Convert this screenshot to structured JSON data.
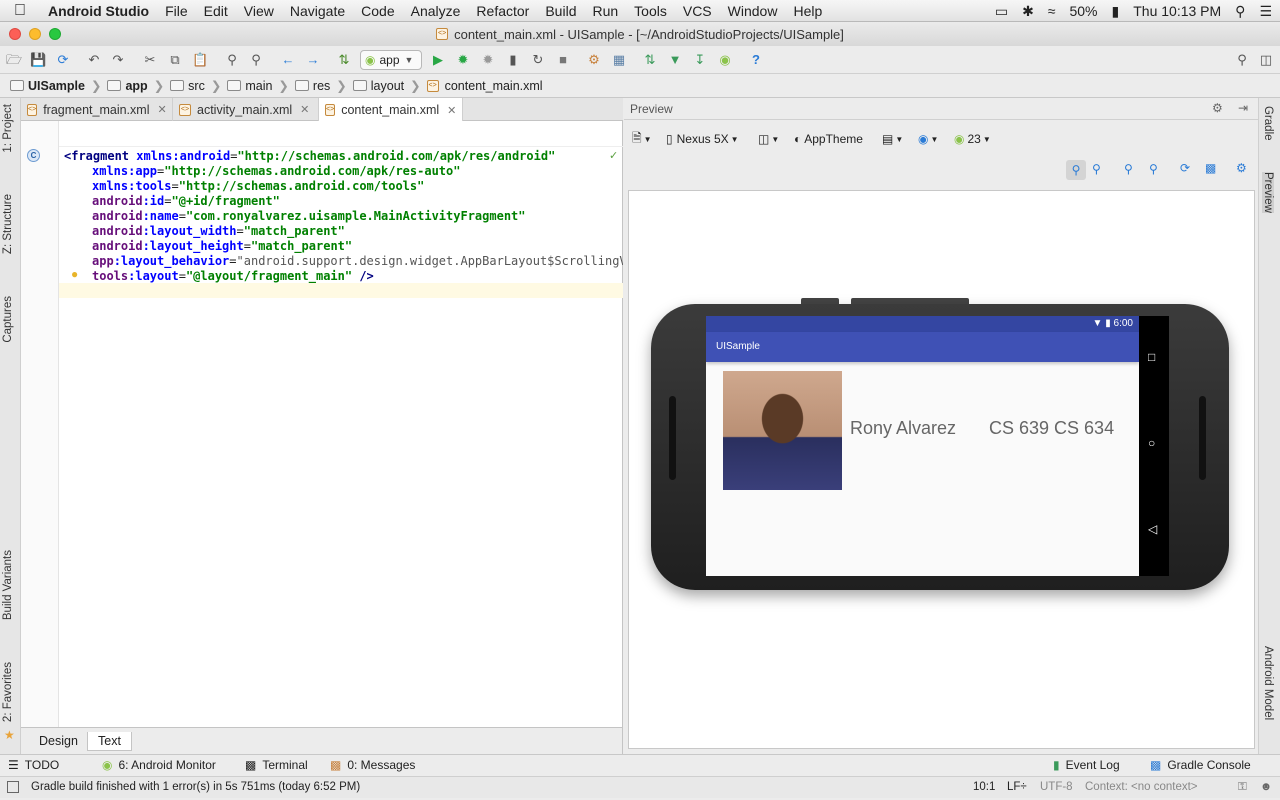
{
  "menubar": {
    "app_name": "Android Studio",
    "items": [
      "File",
      "Edit",
      "View",
      "Navigate",
      "Code",
      "Analyze",
      "Refactor",
      "Build",
      "Run",
      "Tools",
      "VCS",
      "Window",
      "Help"
    ],
    "battery": "50%",
    "clock": "Thu 10:13 PM"
  },
  "window": {
    "title": "content_main.xml - UISample - [~/AndroidStudioProjects/UISample]"
  },
  "toolbar": {
    "run_config": "app",
    "help_glyph": "?"
  },
  "breadcrumb": [
    "UISample",
    "app",
    "src",
    "main",
    "res",
    "layout",
    "content_main.xml"
  ],
  "editor_tabs": [
    {
      "label": "fragment_main.xml"
    },
    {
      "label": "activity_main.xml"
    },
    {
      "label": "content_main.xml"
    }
  ],
  "code": {
    "gutter_badge": "C",
    "line1_tag": "<fragment",
    "line1_attr": "xmlns:android",
    "line1_val": "\"http://schemas.android.com/apk/res/android\"",
    "line2_attr": "xmlns:app",
    "line2_val": "\"http://schemas.android.com/apk/res-auto\"",
    "line3_attr": "xmlns:tools",
    "line3_val": "\"http://schemas.android.com/tools\"",
    "line4_ns": "android",
    "line4_attr": ":id",
    "line4_val": "\"@+id/fragment\"",
    "line5_ns": "android",
    "line5_attr": ":name",
    "line5_val": "\"com.ronyalvarez.uisample.MainActivityFragment\"",
    "line6_ns": "android",
    "line6_attr": ":layout_width",
    "line6_val": "\"match_parent\"",
    "line7_ns": "android",
    "line7_attr": ":layout_height",
    "line7_val": "\"match_parent\"",
    "line8_ns": "app",
    "line8_attr": ":layout_behavior",
    "line8_val": "\"android.support.design.widget.AppBarLayout$ScrollingVie",
    "line9_ns": "tools",
    "line9_attr": ":layout",
    "line9_val": "\"@layout/fragment_main\"",
    "line9_end": " />"
  },
  "editor_bottom_tabs": {
    "design": "Design",
    "text": "Text"
  },
  "left_tools": {
    "project": "1: Project",
    "structure": "Z: Structure",
    "captures": "Captures",
    "build_variants": "Build Variants",
    "favorites": "2: Favorites"
  },
  "right_tools": {
    "gradle": "Gradle",
    "preview": "Preview",
    "android_model": "Android Model"
  },
  "preview": {
    "header": "Preview",
    "device": "Nexus 5X",
    "theme": "AppTheme",
    "api": "23",
    "status_time": "6:00",
    "app_title": "UISample",
    "person_name": "Rony Alvarez",
    "courses": "CS 639 CS 634"
  },
  "bottom_tools": {
    "todo": "TODO",
    "android_monitor": "6: Android Monitor",
    "terminal": "Terminal",
    "messages": "0: Messages",
    "event_log": "Event Log",
    "gradle_console": "Gradle Console"
  },
  "statusbar": {
    "message": "Gradle build finished with 1 error(s) in 5s 751ms (today 6:52 PM)",
    "position": "10:1",
    "line_sep": "LF÷",
    "encoding": "UTF-8",
    "context": "Context: <no context>"
  },
  "colors": {
    "app_bar": "#3f51b5",
    "status_bar": "#3446a2",
    "run_green": "#28a745",
    "android_green": "#8bc34a"
  }
}
